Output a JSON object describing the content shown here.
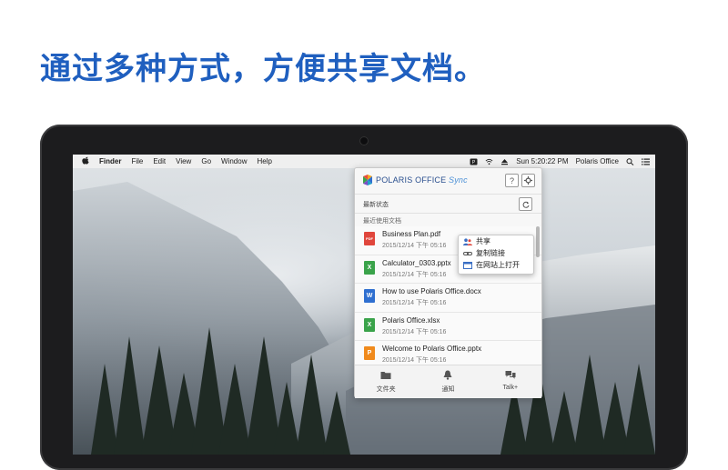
{
  "headline": "通过多种方式，方便共享文档。",
  "menubar": {
    "apple": "",
    "items": [
      "Finder",
      "File",
      "Edit",
      "View",
      "Go",
      "Window",
      "Help"
    ],
    "clock": "Sun 5:20:22 PM",
    "app_name": "Polaris Office"
  },
  "popup": {
    "logo_main": "POLARIS OFFICE",
    "logo_sync": "Sync",
    "help_label": "?",
    "status_label": "最新状态",
    "recent_label": "最近使用文档",
    "files": [
      {
        "name": "Business Plan.pdf",
        "date": "2015/12/14 下午 05:16",
        "type": "pdf",
        "icon_letter": "PDF"
      },
      {
        "name": "Calculator_0303.pptx",
        "date": "2015/12/14 下午 05:16",
        "type": "xlsx",
        "icon_letter": "X"
      },
      {
        "name": "How to use Polaris Office.docx",
        "date": "2015/12/14 下午 05:16",
        "type": "docx",
        "icon_letter": "W"
      },
      {
        "name": "Polaris Office.xlsx",
        "date": "2015/12/14 下午 05:16",
        "type": "xlsx",
        "icon_letter": "X"
      },
      {
        "name": "Welcome to Polaris Office.pptx",
        "date": "2015/12/14 下午 05:16",
        "type": "pptx",
        "icon_letter": "P"
      }
    ],
    "context_menu": [
      "共享",
      "复制链接",
      "在网站上打开"
    ],
    "tabs": [
      "文件夹",
      "通知",
      "Talk+"
    ]
  },
  "colors": {
    "headline": "#1f5fbf",
    "pdf": "#e0463c",
    "xlsx": "#3aa34a",
    "docx": "#2f6fd0",
    "pptx": "#f08a1c"
  }
}
